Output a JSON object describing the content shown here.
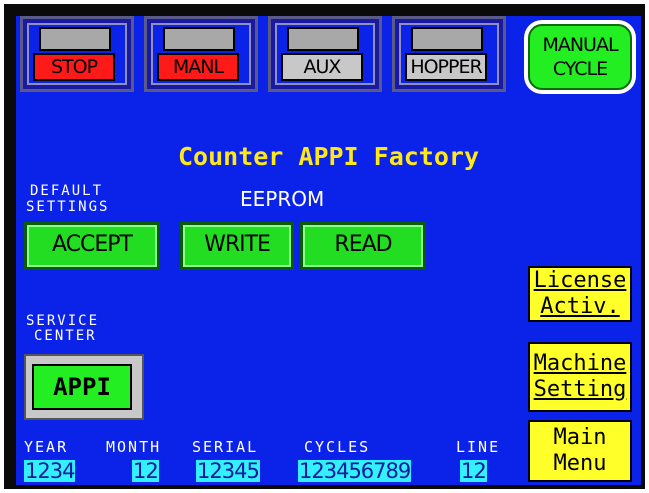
{
  "indicators": [
    {
      "label": "STOP",
      "color": "#ff1a1a"
    },
    {
      "label": "MANL",
      "color": "#ff1a1a"
    },
    {
      "label": "AUX",
      "color": "#c8c8c8"
    },
    {
      "label": "HOPPER",
      "color": "#c8c8c8"
    }
  ],
  "manual_cycle": {
    "line1": "MANUAL",
    "line2": "CYCLE"
  },
  "title": "Counter APPI Factory",
  "default_settings": {
    "line1": "DEFAULT",
    "line2": "SETTINGS",
    "accept": "ACCEPT"
  },
  "eeprom": {
    "label": "EEPROM",
    "write": "WRITE",
    "read": "READ"
  },
  "service_center": {
    "line1": "SERVICE",
    "line2": "CENTER",
    "button": "APPI"
  },
  "side_buttons": {
    "license": {
      "line1": "License",
      "line2": "Activ."
    },
    "machine": {
      "line1": "Machine",
      "line2": "Setting"
    },
    "main": {
      "line1": "Main",
      "line2": "Menu"
    }
  },
  "fields": {
    "year": {
      "label": "YEAR",
      "value": "1234"
    },
    "month": {
      "label": "MONTH",
      "value": "12"
    },
    "serial": {
      "label": "SERIAL",
      "value": "12345"
    },
    "cycles": {
      "label": "CYCLES",
      "value": "123456789"
    },
    "line": {
      "label": "LINE",
      "value": "12"
    }
  },
  "colors": {
    "background": "#0b22e8",
    "accent_green": "#22ee22",
    "accent_yellow": "#ffff2a",
    "title": "#ffe81a",
    "field": "#33f0ff"
  }
}
